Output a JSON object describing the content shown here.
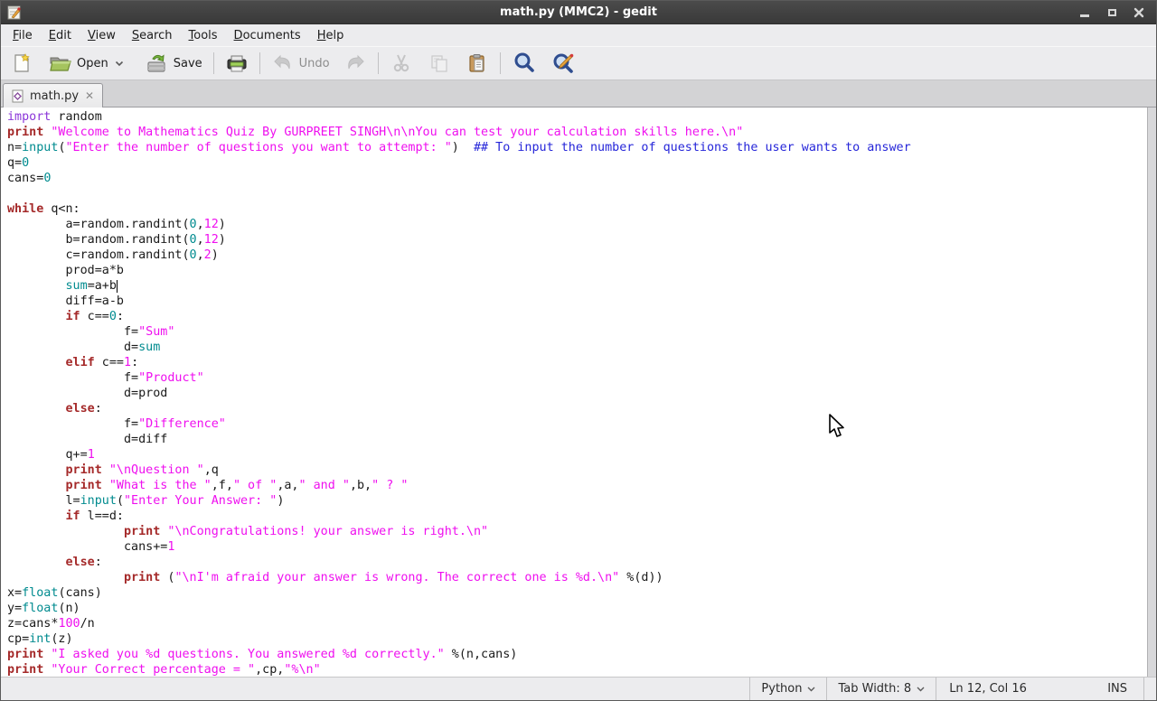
{
  "window": {
    "title": "math.py (MMC2) - gedit"
  },
  "menu": {
    "items": [
      {
        "label": "File"
      },
      {
        "label": "Edit"
      },
      {
        "label": "View"
      },
      {
        "label": "Search"
      },
      {
        "label": "Tools"
      },
      {
        "label": "Documents"
      },
      {
        "label": "Help"
      }
    ]
  },
  "toolbar": {
    "open_label": "Open",
    "save_label": "Save",
    "undo_label": "Undo"
  },
  "tabbar": {
    "tab": {
      "label": "math.py",
      "close_glyph": "✕"
    }
  },
  "editor": {
    "cursor": {
      "line": 12,
      "col": 16
    },
    "lines": [
      [
        [
          "i",
          "import"
        ],
        [
          "p",
          " random"
        ]
      ],
      [
        [
          "k",
          "print"
        ],
        [
          "p",
          " "
        ],
        [
          "s",
          "\"Welcome to Mathematics Quiz By GURPREET SINGH\\n\\nYou can test your calculation skills here.\\n\""
        ]
      ],
      [
        [
          "p",
          "n="
        ],
        [
          "t",
          "input"
        ],
        [
          "p",
          "("
        ],
        [
          "s",
          "\"Enter the number of questions you want to attempt: \""
        ],
        [
          "p",
          ")  "
        ],
        [
          "c",
          "## To input the number of questions the user wants to answer"
        ]
      ],
      [
        [
          "p",
          "q="
        ],
        [
          "t",
          "0"
        ]
      ],
      [
        [
          "p",
          "cans="
        ],
        [
          "t",
          "0"
        ]
      ],
      [],
      [
        [
          "k",
          "while"
        ],
        [
          "p",
          " q<n:"
        ]
      ],
      [
        [
          "p",
          "        a=random.randint("
        ],
        [
          "t",
          "0"
        ],
        [
          "p",
          ","
        ],
        [
          "n",
          "12"
        ],
        [
          "p",
          ")"
        ]
      ],
      [
        [
          "p",
          "        b=random.randint("
        ],
        [
          "t",
          "0"
        ],
        [
          "p",
          ","
        ],
        [
          "n",
          "12"
        ],
        [
          "p",
          ")"
        ]
      ],
      [
        [
          "p",
          "        c=random.randint("
        ],
        [
          "t",
          "0"
        ],
        [
          "p",
          ","
        ],
        [
          "n",
          "2"
        ],
        [
          "p",
          ")"
        ]
      ],
      [
        [
          "p",
          "        prod=a*b"
        ]
      ],
      [
        [
          "p",
          "        "
        ],
        [
          "t",
          "sum"
        ],
        [
          "p",
          "=a+b"
        ]
      ],
      [
        [
          "p",
          "        diff=a-b"
        ]
      ],
      [
        [
          "p",
          "        "
        ],
        [
          "k",
          "if"
        ],
        [
          "p",
          " c=="
        ],
        [
          "t",
          "0"
        ],
        [
          "p",
          ":"
        ]
      ],
      [
        [
          "p",
          "                f="
        ],
        [
          "s",
          "\"Sum\""
        ]
      ],
      [
        [
          "p",
          "                d="
        ],
        [
          "t",
          "sum"
        ]
      ],
      [
        [
          "p",
          "        "
        ],
        [
          "k",
          "elif"
        ],
        [
          "p",
          " c=="
        ],
        [
          "n",
          "1"
        ],
        [
          "p",
          ":"
        ]
      ],
      [
        [
          "p",
          "                f="
        ],
        [
          "s",
          "\"Product\""
        ]
      ],
      [
        [
          "p",
          "                d=prod"
        ]
      ],
      [
        [
          "p",
          "        "
        ],
        [
          "k",
          "else"
        ],
        [
          "p",
          ":"
        ]
      ],
      [
        [
          "p",
          "                f="
        ],
        [
          "s",
          "\"Difference\""
        ]
      ],
      [
        [
          "p",
          "                d=diff"
        ]
      ],
      [
        [
          "p",
          "        q+="
        ],
        [
          "n",
          "1"
        ]
      ],
      [
        [
          "p",
          "        "
        ],
        [
          "k",
          "print"
        ],
        [
          "p",
          " "
        ],
        [
          "s",
          "\"\\nQuestion \""
        ],
        [
          "p",
          ",q"
        ]
      ],
      [
        [
          "p",
          "        "
        ],
        [
          "k",
          "print"
        ],
        [
          "p",
          " "
        ],
        [
          "s",
          "\"What is the \""
        ],
        [
          "p",
          ",f,"
        ],
        [
          "s",
          "\" of \""
        ],
        [
          "p",
          ",a,"
        ],
        [
          "s",
          "\" and \""
        ],
        [
          "p",
          ",b,"
        ],
        [
          "s",
          "\" ? \""
        ]
      ],
      [
        [
          "p",
          "        l="
        ],
        [
          "t",
          "input"
        ],
        [
          "p",
          "("
        ],
        [
          "s",
          "\"Enter Your Answer: \""
        ],
        [
          "p",
          ")"
        ]
      ],
      [
        [
          "p",
          "        "
        ],
        [
          "k",
          "if"
        ],
        [
          "p",
          " l==d:"
        ]
      ],
      [
        [
          "p",
          "                "
        ],
        [
          "k",
          "print"
        ],
        [
          "p",
          " "
        ],
        [
          "s",
          "\"\\nCongratulations! your answer is right.\\n\""
        ]
      ],
      [
        [
          "p",
          "                cans+="
        ],
        [
          "n",
          "1"
        ]
      ],
      [
        [
          "p",
          "        "
        ],
        [
          "k",
          "else"
        ],
        [
          "p",
          ":"
        ]
      ],
      [
        [
          "p",
          "                "
        ],
        [
          "k",
          "print"
        ],
        [
          "p",
          " ("
        ],
        [
          "s",
          "\"\\nI'm afraid your answer is wrong. The correct one is %d.\\n\""
        ],
        [
          "p",
          " %(d))"
        ]
      ],
      [
        [
          "p",
          "x="
        ],
        [
          "t",
          "float"
        ],
        [
          "p",
          "(cans)"
        ]
      ],
      [
        [
          "p",
          "y="
        ],
        [
          "t",
          "float"
        ],
        [
          "p",
          "(n)"
        ]
      ],
      [
        [
          "p",
          "z=cans*"
        ],
        [
          "n",
          "100"
        ],
        [
          "p",
          "/n"
        ]
      ],
      [
        [
          "p",
          "cp="
        ],
        [
          "t",
          "int"
        ],
        [
          "p",
          "(z)"
        ]
      ],
      [
        [
          "k",
          "print"
        ],
        [
          "p",
          " "
        ],
        [
          "s",
          "\"I asked you %d questions. You answered %d correctly.\""
        ],
        [
          "p",
          " %(n,cans)"
        ]
      ],
      [
        [
          "k",
          "print"
        ],
        [
          "p",
          " "
        ],
        [
          "s",
          "\"Your Correct percentage = \""
        ],
        [
          "p",
          ",cp,"
        ],
        [
          "s",
          "\"%\\n\""
        ]
      ]
    ]
  },
  "statusbar": {
    "language": "Python",
    "tab_width": "Tab Width: 8",
    "position": "Ln 12, Col 16",
    "mode": "INS"
  },
  "colors": {
    "keyword": "#a52a2a",
    "import_keyword": "#8b36d9",
    "string": "#ef0fef",
    "number": "#ef0fef",
    "builtin": "#008b8f",
    "comment": "#2626d9",
    "titlebar_bg": "#3f3f3f",
    "chrome_bg": "#ececee"
  }
}
